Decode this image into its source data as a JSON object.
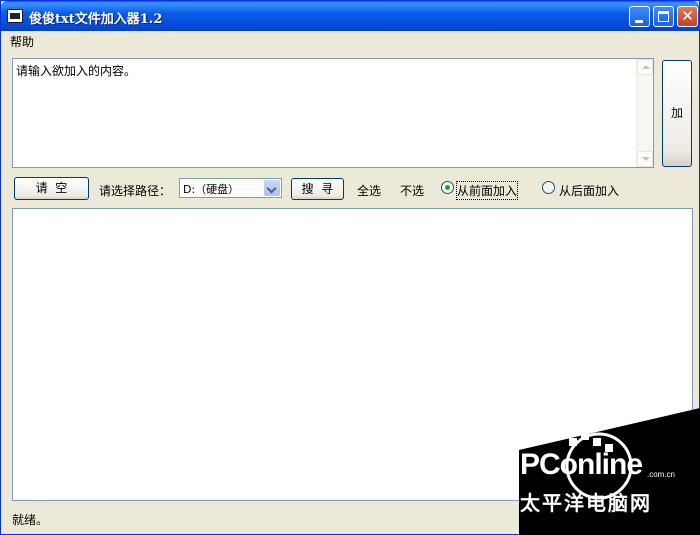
{
  "window": {
    "title": "俊俊txt文件加入器1.2",
    "close_glyph": "✕"
  },
  "menu": {
    "items": [
      "帮助"
    ]
  },
  "content": {
    "placeholder_text": "请输入欲加入的内容。"
  },
  "add_button": {
    "label": "加"
  },
  "controls": {
    "clear_label": "请  空",
    "path_label": "请选择路径：",
    "drive_value": "D:（硬盘）",
    "search_label": "搜  寻",
    "select_all": "全选",
    "select_none": "不选",
    "radio_front": "从前面加入",
    "radio_back": "从后面加入",
    "selected_radio": "radio_front"
  },
  "status": {
    "text": "就绪。"
  },
  "watermark": {
    "brand": "PConline",
    "domain": ".com.cn",
    "chinese": "太平洋电脑网"
  },
  "colors": {
    "titlebar": "#0548d8",
    "window_bg": "#ece9d8",
    "radio_dot": "#21a121",
    "close_button": "#c2421e",
    "watermark_bg": "#000000"
  }
}
